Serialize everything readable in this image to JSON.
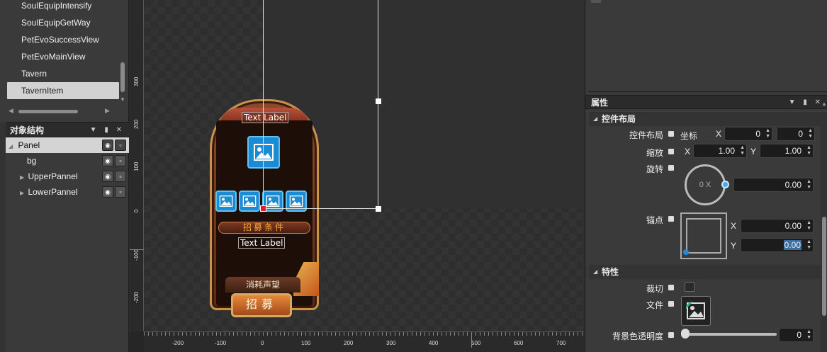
{
  "scene_list": {
    "items": [
      "SoulEquipIntensify",
      "SoulEquipGetWay",
      "PetEvoSuccessView",
      "PetEvoMainView",
      "Tavern",
      "TavernItem"
    ],
    "selected": "TavernItem"
  },
  "object_structure": {
    "title": "对象结构",
    "nodes": [
      {
        "label": "Panel",
        "expander": "◢",
        "selected": true
      },
      {
        "label": "bg",
        "expander": ""
      },
      {
        "label": "UpperPannel",
        "expander": "▶"
      },
      {
        "label": "LowerPannel",
        "expander": "▶"
      }
    ]
  },
  "canvas": {
    "v_ticks": [
      "300",
      "200",
      "100",
      "0",
      "-100",
      "-200"
    ],
    "h_ticks": [
      "-200",
      "-100",
      "0",
      "100",
      "200",
      "300",
      "400",
      "500",
      "600",
      "700"
    ],
    "card": {
      "top_label": "Text Label",
      "bar_text": "招募条件",
      "mid_label": "Text Label",
      "consume_text": "消耗声望",
      "recruit_text": "招募"
    }
  },
  "properties": {
    "title": "属性",
    "layout_section": "控件布局",
    "layout_label": "控件布局",
    "coord_label": "坐标",
    "x_label": "X",
    "y_label": "Y",
    "pos_x": "0",
    "pos_y": "0",
    "scale_label": "缩放",
    "scale_x": "1.00",
    "scale_y": "1.00",
    "rotate_label": "旋转",
    "rotate_dial": "0 X",
    "rotate_value": "0.00",
    "anchor_label": "锚点",
    "anchor_x": "0.00",
    "anchor_y": "0.00",
    "features_section": "特性",
    "clip_label": "裁切",
    "file_label": "文件",
    "bg_alpha_label": "背景色透明度",
    "bg_alpha_value": "0"
  },
  "colors": {
    "accent": "#1b8cd4",
    "selection": "#d2d2d2",
    "panel_bg": "#3a3a3a"
  }
}
